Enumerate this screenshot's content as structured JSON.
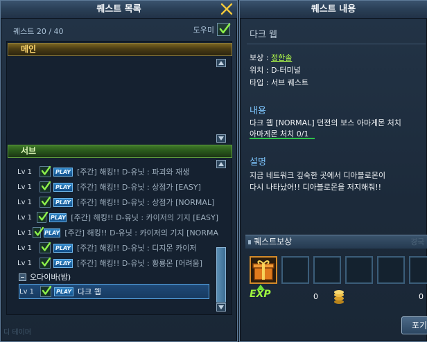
{
  "left_window": {
    "title": "퀘스트 목록",
    "count": "퀘스트 20 / 40",
    "helper_label": "도우미",
    "helper_checked": true,
    "main_category": "메인",
    "sub_category": "서브",
    "quests": [
      {
        "level": "Lv 1",
        "play": "PLAY",
        "title": "[주간] 해킹!! D-유닛 : 파괴와 재생"
      },
      {
        "level": "Lv 1",
        "play": "PLAY",
        "title": "[주간] 해킹!! D-유닛 : 상점가 [EASY]"
      },
      {
        "level": "Lv 1",
        "play": "PLAY",
        "title": "[주간] 해킹!! D-유닛 : 상점가 [NORMAL]"
      },
      {
        "level": "Lv 1",
        "play": "PLAY",
        "title": "[주간] 해킹!! D-유닛 : 카이저의 기지 [EASY]"
      },
      {
        "level": "Lv 1",
        "play": "PLAY",
        "title": "[주간] 해킹!! D-유닛 : 카이저의 기지 [NORMA"
      },
      {
        "level": "Lv 1",
        "play": "PLAY",
        "title": "[주간] 해킹!! D-유닛 : 디지몬 카이저"
      },
      {
        "level": "Lv 1",
        "play": "PLAY",
        "title": "[주간] 해킹!! D-유닛 : 황룡몬 [어려움]"
      }
    ],
    "group_label": "오다이바(밤)",
    "selected_quest": {
      "level": "Lv 1",
      "play": "PLAY",
      "title": "다크 웹"
    },
    "watermark": "디 테이머"
  },
  "right_window": {
    "title": "퀘스트 내용",
    "quest_name": "다크 웹",
    "reward_label": "보상 : ",
    "reward_name": "정한솔",
    "location": "위치 : D-터미널",
    "type": "타입 : 서브 퀘스트",
    "content_title": "내용",
    "content_line1": "다크 웹 [NORMAL] 던전의 보스 아마게몬 처치",
    "objective": "아마게몬 처치 0/1",
    "desc_title": "설명",
    "desc_line1": "지금 네트워크 깊숙한 곳에서 디아블로몬이",
    "desc_line2": "다시 나타났어!! 디아블로몬을 저지해줘!!",
    "reward_header": "퀘스트보상",
    "reward_header_ghost": "경국",
    "exp_label": "EXP",
    "exp_value": "0",
    "gold_value": "0",
    "giveup_label": "포기"
  },
  "colors": {
    "accent_blue": "#7fc7ff",
    "reward_green": "#b3ff4a",
    "main_gold": "#ffd870"
  }
}
